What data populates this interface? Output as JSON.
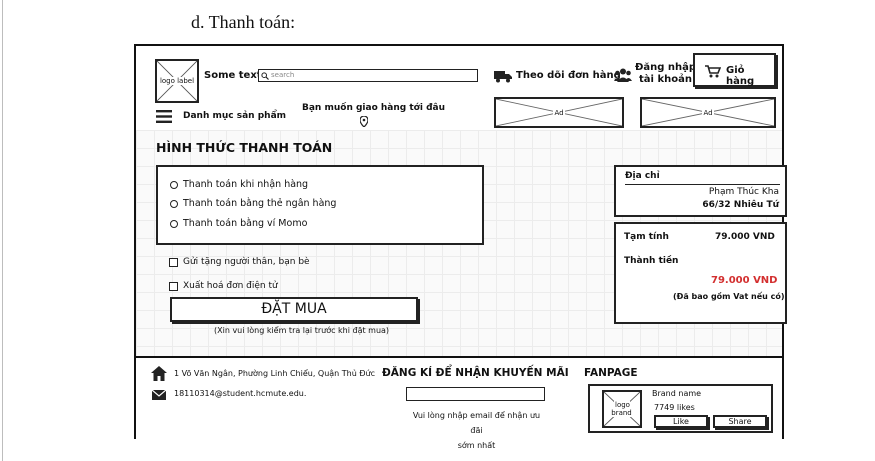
{
  "doc": {
    "heading": "d.   Thanh toán:"
  },
  "header": {
    "logo_label": "logo label",
    "some_text": "Some text",
    "search_placeholder": "search",
    "track_order": "Theo dõi đơn hàng",
    "login_line1": "Đăng nhập",
    "login_line2": "tài khoản",
    "cart": "Giỏ hàng",
    "category": "Danh mục sản phẩm",
    "delivery": "Bạn muốn giao hàng tới đâu",
    "ad1": "Ad",
    "ad2": "Ad"
  },
  "main": {
    "section_title": "HÌNH THỨC THANH TOÁN",
    "payment_options": [
      "Thanh toán khi nhận hàng",
      "Thanh toán bằng thẻ ngân hàng",
      "Thanh toán bằng ví Momo"
    ],
    "gift_option": "Gửi tặng người thân, bạn bè",
    "invoice_option": "Xuất hoá đơn điện tử",
    "order_button": "ĐẶT MUA",
    "order_note": "(Xin vui lòng kiểm tra lại trước khi đặt mua)"
  },
  "address": {
    "label": "Địa chỉ",
    "name": "Phạm Thúc Kha",
    "street": "66/32 Nhiêu Tứ"
  },
  "summary": {
    "subtotal_label": "Tạm tính",
    "subtotal_value": "79.000 VND",
    "total_label": "Thành tiền",
    "total_value": "79.000 VND",
    "vat_note": "(Đã bao gồm Vat nếu có)"
  },
  "footer": {
    "address": "1 Võ Văn Ngân, Phường Linh Chiểu, Quận Thủ Đức",
    "email": "18110314@student.hcmute.edu.",
    "promo_title": "ĐĂNG KÍ ĐỂ NHẬN KHUYẾN MÃI",
    "promo_note_line1": "Vui lòng nhập email để nhận ưu đãi",
    "promo_note_line2": "sớm nhất",
    "fanpage_title": "FANPAGE",
    "brand_logo": "logo brand",
    "brand_name": "Brand name",
    "likes": "7749 likes",
    "like_button": "Like",
    "share_button": "Share"
  },
  "colors": {
    "price": "#d32f2f",
    "border": "#222222",
    "grid": "#ececec"
  }
}
